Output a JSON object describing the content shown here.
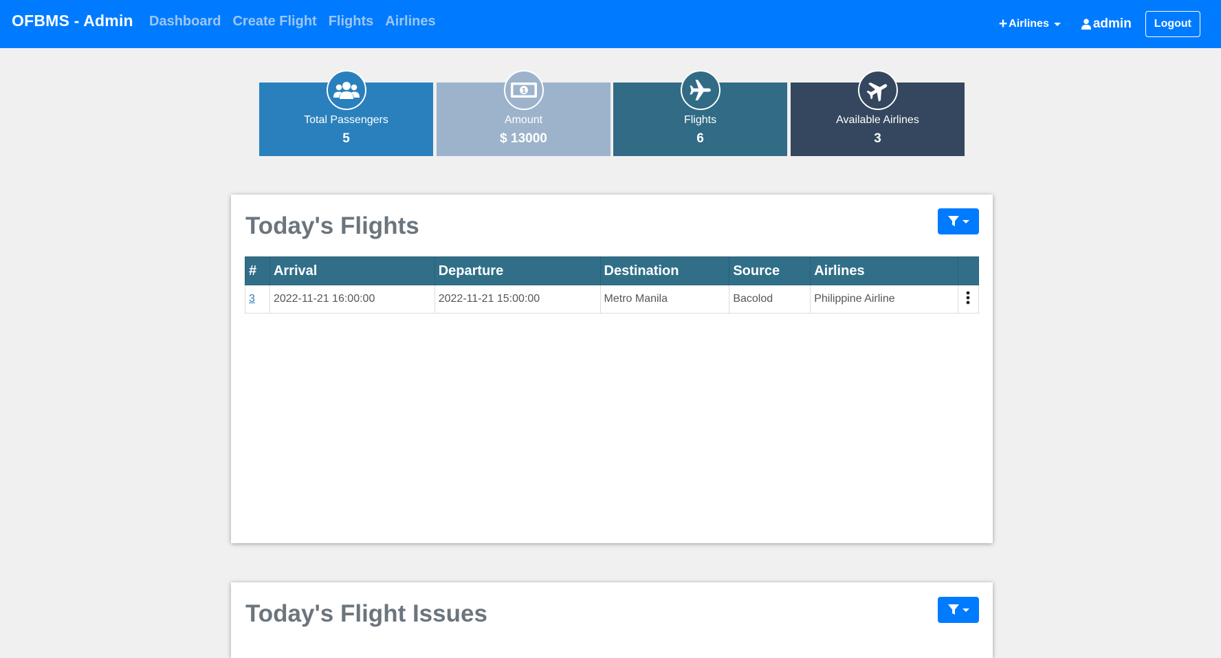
{
  "navbar": {
    "brand": "OFBMS - Admin",
    "links": [
      "Dashboard",
      "Create Flight",
      "Flights",
      "Airlines"
    ],
    "airlines_dropdown": "Airlines",
    "user": "admin",
    "logout": "Logout",
    "color": "#007bff"
  },
  "stats": [
    {
      "label": "Total Passengers",
      "value": "5",
      "icon": "users-icon",
      "color": "#2a80bd"
    },
    {
      "label": "Amount",
      "value": "$ 13000",
      "icon": "money-bill-icon",
      "color": "#9db3cc"
    },
    {
      "label": "Flights",
      "value": "6",
      "icon": "plane-icon",
      "color": "#316b85"
    },
    {
      "label": "Available Airlines",
      "value": "3",
      "icon": "plane-icon",
      "color": "#34475e"
    }
  ],
  "todays_flights": {
    "title": "Today's Flights",
    "columns": [
      "#",
      "Arrival",
      "Departure",
      "Destination",
      "Source",
      "Airlines",
      ""
    ],
    "rows": [
      {
        "id": "3",
        "arrival": "2022-11-21 16:00:00",
        "departure": "2022-11-21 15:00:00",
        "destination": "Metro Manila",
        "source": "Bacolod",
        "airline": "Philippine Airline"
      }
    ]
  },
  "todays_issues": {
    "title": "Today's Flight Issues"
  }
}
